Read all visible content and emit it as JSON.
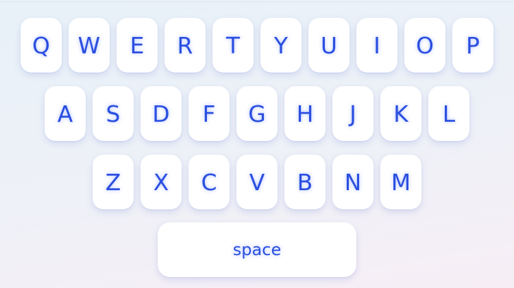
{
  "keyboard": {
    "rows": [
      [
        "Q",
        "W",
        "E",
        "R",
        "T",
        "Y",
        "U",
        "I",
        "O",
        "P"
      ],
      [
        "A",
        "S",
        "D",
        "F",
        "G",
        "H",
        "J",
        "K",
        "L"
      ],
      [
        "Z",
        "X",
        "C",
        "V",
        "B",
        "N",
        "M"
      ]
    ],
    "space_label": "space"
  },
  "colors": {
    "key_text": "#2b4fe0",
    "key_background": "#ffffff",
    "page_background": "#eaf1f7"
  }
}
